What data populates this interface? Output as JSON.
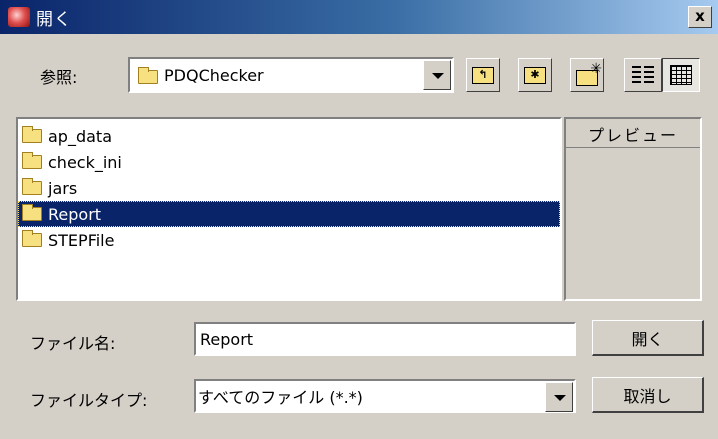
{
  "window": {
    "title": "開く",
    "close_label": "x"
  },
  "look_in": {
    "label": "参照:",
    "value": "PDQChecker"
  },
  "toolbar": {
    "up_icon": "folder-up-icon",
    "home_icon": "home-folder-icon",
    "new_folder_icon": "new-folder-icon",
    "list_view_icon": "list-view-icon",
    "details_view_icon": "details-view-icon",
    "active_view": "details"
  },
  "files": [
    {
      "name": "ap_data",
      "type": "folder",
      "selected": false
    },
    {
      "name": "check_ini",
      "type": "folder",
      "selected": false
    },
    {
      "name": "jars",
      "type": "folder",
      "selected": false
    },
    {
      "name": "Report",
      "type": "folder",
      "selected": true
    },
    {
      "name": "STEPFile",
      "type": "folder",
      "selected": false
    }
  ],
  "preview": {
    "label": "プレビュー"
  },
  "file_name": {
    "label": "ファイル名:",
    "value": "Report"
  },
  "file_type": {
    "label": "ファイルタイプ:",
    "value": "すべてのファイル (*.*)"
  },
  "buttons": {
    "open_label": "開く",
    "cancel_label": "取消し"
  },
  "colors": {
    "selection": "#0a246a",
    "dialog_bg": "#d4d0c8",
    "title_gradient_start": "#0a246a"
  }
}
